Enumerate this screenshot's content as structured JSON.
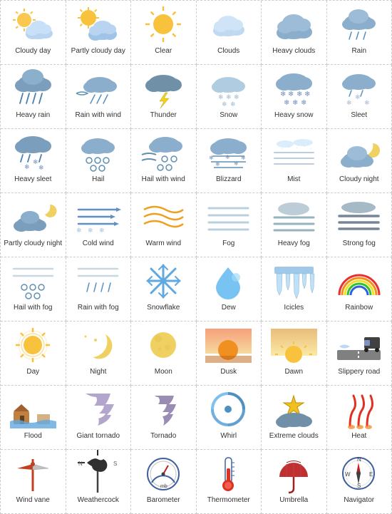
{
  "items": [
    {
      "id": "cloudy-day",
      "label": "Cloudy day",
      "icon": "cloudy-day"
    },
    {
      "id": "partly-cloudy-day",
      "label": "Partly cloudy day",
      "icon": "partly-cloudy-day"
    },
    {
      "id": "clear",
      "label": "Clear",
      "icon": "clear"
    },
    {
      "id": "clouds",
      "label": "Clouds",
      "icon": "clouds"
    },
    {
      "id": "heavy-clouds",
      "label": "Heavy clouds",
      "icon": "heavy-clouds"
    },
    {
      "id": "rain",
      "label": "Rain",
      "icon": "rain"
    },
    {
      "id": "heavy-rain",
      "label": "Heavy rain",
      "icon": "heavy-rain"
    },
    {
      "id": "rain-with-wind",
      "label": "Rain with wind",
      "icon": "rain-with-wind"
    },
    {
      "id": "thunder",
      "label": "Thunder",
      "icon": "thunder"
    },
    {
      "id": "snow",
      "label": "Snow",
      "icon": "snow"
    },
    {
      "id": "heavy-snow",
      "label": "Heavy snow",
      "icon": "heavy-snow"
    },
    {
      "id": "sleet",
      "label": "Sleet",
      "icon": "sleet"
    },
    {
      "id": "heavy-sleet",
      "label": "Heavy sleet",
      "icon": "heavy-sleet"
    },
    {
      "id": "hail",
      "label": "Hail",
      "icon": "hail"
    },
    {
      "id": "hail-with-wind",
      "label": "Hail with wind",
      "icon": "hail-with-wind"
    },
    {
      "id": "blizzard",
      "label": "Blizzard",
      "icon": "blizzard"
    },
    {
      "id": "mist",
      "label": "Mist",
      "icon": "mist"
    },
    {
      "id": "cloudy-night",
      "label": "Cloudy night",
      "icon": "cloudy-night"
    },
    {
      "id": "partly-cloudy-night",
      "label": "Partly cloudy night",
      "icon": "partly-cloudy-night"
    },
    {
      "id": "cold-wind",
      "label": "Cold wind",
      "icon": "cold-wind"
    },
    {
      "id": "warm-wind",
      "label": "Warm wind",
      "icon": "warm-wind"
    },
    {
      "id": "fog",
      "label": "Fog",
      "icon": "fog"
    },
    {
      "id": "heavy-fog",
      "label": "Heavy fog",
      "icon": "heavy-fog"
    },
    {
      "id": "strong-fog",
      "label": "Strong fog",
      "icon": "strong-fog"
    },
    {
      "id": "hail-with-fog",
      "label": "Hail with fog",
      "icon": "hail-with-fog"
    },
    {
      "id": "rain-with-fog",
      "label": "Rain with fog",
      "icon": "rain-with-fog"
    },
    {
      "id": "snowflake",
      "label": "Snowflake",
      "icon": "snowflake"
    },
    {
      "id": "dew",
      "label": "Dew",
      "icon": "dew"
    },
    {
      "id": "icicles",
      "label": "Icicles",
      "icon": "icicles"
    },
    {
      "id": "rainbow",
      "label": "Rainbow",
      "icon": "rainbow"
    },
    {
      "id": "day",
      "label": "Day",
      "icon": "day"
    },
    {
      "id": "night",
      "label": "Night",
      "icon": "night"
    },
    {
      "id": "moon",
      "label": "Moon",
      "icon": "moon"
    },
    {
      "id": "dusk",
      "label": "Dusk",
      "icon": "dusk"
    },
    {
      "id": "dawn",
      "label": "Dawn",
      "icon": "dawn"
    },
    {
      "id": "slippery-road",
      "label": "Slippery road",
      "icon": "slippery-road"
    },
    {
      "id": "flood",
      "label": "Flood",
      "icon": "flood"
    },
    {
      "id": "giant-tornado",
      "label": "Giant tornado",
      "icon": "giant-tornado"
    },
    {
      "id": "tornado",
      "label": "Tornado",
      "icon": "tornado"
    },
    {
      "id": "whirl",
      "label": "Whirl",
      "icon": "whirl"
    },
    {
      "id": "extreme-clouds",
      "label": "Extreme clouds",
      "icon": "extreme-clouds"
    },
    {
      "id": "heat",
      "label": "Heat",
      "icon": "heat"
    },
    {
      "id": "wind-vane",
      "label": "Wind vane",
      "icon": "wind-vane"
    },
    {
      "id": "weathercock",
      "label": "Weathercock",
      "icon": "weathercock"
    },
    {
      "id": "barometer",
      "label": "Barometer",
      "icon": "barometer"
    },
    {
      "id": "thermometer",
      "label": "Thermometer",
      "icon": "thermometer"
    },
    {
      "id": "umbrella",
      "label": "Umbrella",
      "icon": "umbrella"
    },
    {
      "id": "navigator",
      "label": "Navigator",
      "icon": "navigator"
    }
  ]
}
